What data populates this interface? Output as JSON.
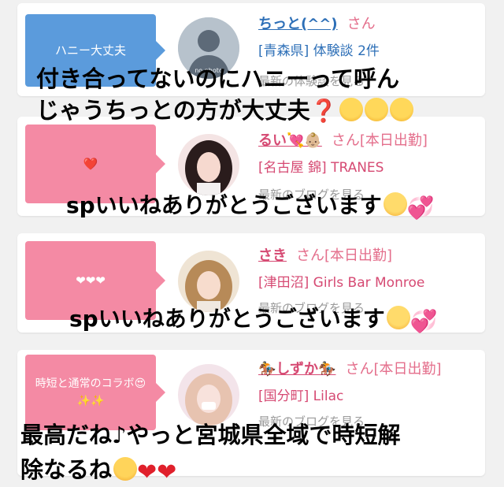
{
  "posts": [
    {
      "bubble_text": "ハニー大丈夫",
      "name": "ちっと(^^)",
      "name_suffix": "さん",
      "area": "[青森県] 体験談 2件",
      "avatar_label": "no photo",
      "blog_text": "最新の体験談を見る"
    },
    {
      "bubble_text": "❤️",
      "name": "るい💘👶🏼",
      "name_suffix": "さん[本日出勤]",
      "area": "[名古屋 錦] TRANES",
      "blog_text": "最新のブログを見る"
    },
    {
      "bubble_text": "❤❤❤",
      "name": "さき",
      "name_suffix": "さん[本日出勤]",
      "area": "[津田沼] Girls Bar Monroe",
      "blog_text": "最新のブログを見る"
    },
    {
      "bubble_text": "時短と通常のコラボ😍✨✨",
      "name": "🏇しずか🏇",
      "name_suffix": "さん[本日出勤]",
      "area": "[国分町] Lilac",
      "blog_text": "最新のブログを見る"
    }
  ],
  "captions": {
    "c1_line1": "付き合ってないのにハニーって呼ん",
    "c1_line2": "じゃうちっとの方が大丈夫",
    "c2": "spいいねありがとうございます",
    "c3": "spいいねありがとうございます",
    "c4_line1": "最高だね♪やっと宮城県全域で時短解",
    "c4_line2": "除なるね"
  },
  "icons": [
    "question-mark-icon",
    "thinking-face-icon",
    "relieved-face-icon",
    "two-hearts-icon",
    "hugging-face-icon",
    "red-heart-icon"
  ],
  "colors": {
    "blue_bubble": "#5b9bdc",
    "pink_bubble": "#f48aa4",
    "user_name": "#2d6fb7",
    "cast_name": "#d64a73",
    "area_blue": "#2d6fb7",
    "area_pink": "#d64a73"
  }
}
